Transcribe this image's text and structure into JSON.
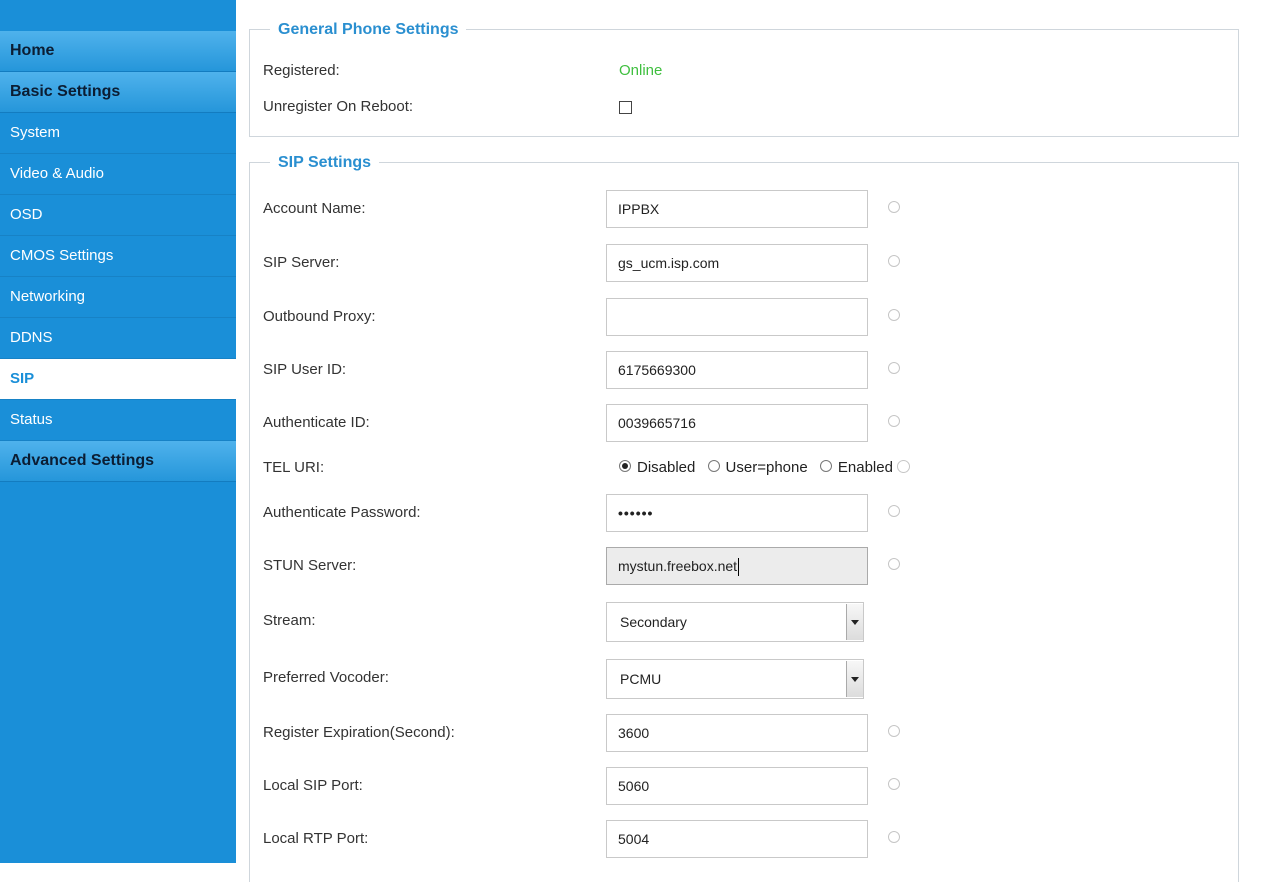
{
  "sidebar": {
    "items": [
      {
        "label": "Home"
      },
      {
        "label": "Basic Settings"
      },
      {
        "label": "System"
      },
      {
        "label": "Video & Audio"
      },
      {
        "label": "OSD"
      },
      {
        "label": "CMOS Settings"
      },
      {
        "label": "Networking"
      },
      {
        "label": "DDNS"
      },
      {
        "label": "SIP"
      },
      {
        "label": "Status"
      },
      {
        "label": "Advanced Settings"
      }
    ]
  },
  "general": {
    "legend": "General Phone Settings",
    "registered_label": "Registered:",
    "registered_value": "Online",
    "unregister_label": "Unregister On Reboot:"
  },
  "sip": {
    "legend": "SIP Settings",
    "account_name_label": "Account Name:",
    "account_name_value": "IPPBX",
    "sip_server_label": "SIP Server:",
    "sip_server_value": "gs_ucm.isp.com",
    "outbound_proxy_label": "Outbound Proxy:",
    "outbound_proxy_value": "",
    "sip_user_id_label": "SIP User ID:",
    "sip_user_id_value": "6175669300",
    "auth_id_label": "Authenticate ID:",
    "auth_id_value": "0039665716",
    "tel_uri_label": "TEL URI:",
    "tel_uri_options": [
      "Disabled",
      "User=phone",
      "Enabled"
    ],
    "tel_uri_selected": "Disabled",
    "auth_password_label": "Authenticate Password:",
    "auth_password_value": "••••••",
    "stun_server_label": "STUN Server:",
    "stun_server_value": "mystun.freebox.net",
    "stream_label": "Stream:",
    "stream_value": "Secondary",
    "vocoder_label": "Preferred Vocoder:",
    "vocoder_value": "PCMU",
    "reg_exp_label": "Register Expiration(Second):",
    "reg_exp_value": "3600",
    "local_sip_port_label": "Local SIP Port:",
    "local_sip_port_value": "5060",
    "local_rtp_port_label": "Local RTP Port:",
    "local_rtp_port_value": "5004"
  },
  "colors": {
    "sidebar_bg": "#1a8fd8",
    "legend": "#2a8fd0",
    "online": "#3fbf3f"
  }
}
